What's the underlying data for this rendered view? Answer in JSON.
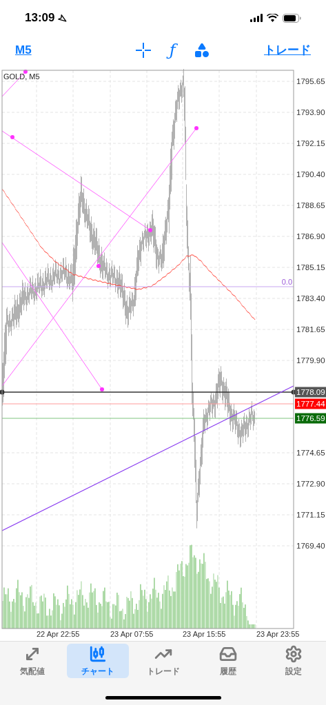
{
  "status_bar": {
    "time": "13:09"
  },
  "toolbar": {
    "timeframe": "M5",
    "function_glyph": "ƒ",
    "trade_link": "トレード"
  },
  "chart": {
    "symbol_label": "GOLD, M5",
    "price_ticks": [
      "1795.65",
      "1793.90",
      "1792.15",
      "1790.40",
      "1788.65",
      "1786.90",
      "1785.15",
      "1783.40",
      "1781.65",
      "1779.90",
      "1774.65",
      "1772.90",
      "1771.15",
      "1769.40"
    ],
    "time_ticks": [
      "22 Apr 22:55",
      "23 Apr 07:55",
      "23 Apr 15:55",
      "23 Apr 23:55"
    ],
    "fibo_label": "0.0",
    "price_markers": [
      {
        "label": "1778.09",
        "color": "#555555"
      },
      {
        "label": "1777.44",
        "color": "#ff0000"
      },
      {
        "label": "1776.59",
        "color": "#0a6b0a"
      }
    ]
  },
  "tabs": [
    {
      "label": "気配値",
      "selected": false
    },
    {
      "label": "チャート",
      "selected": true
    },
    {
      "label": "トレード",
      "selected": false
    },
    {
      "label": "履歴",
      "selected": false
    },
    {
      "label": "設定",
      "selected": false
    }
  ]
}
